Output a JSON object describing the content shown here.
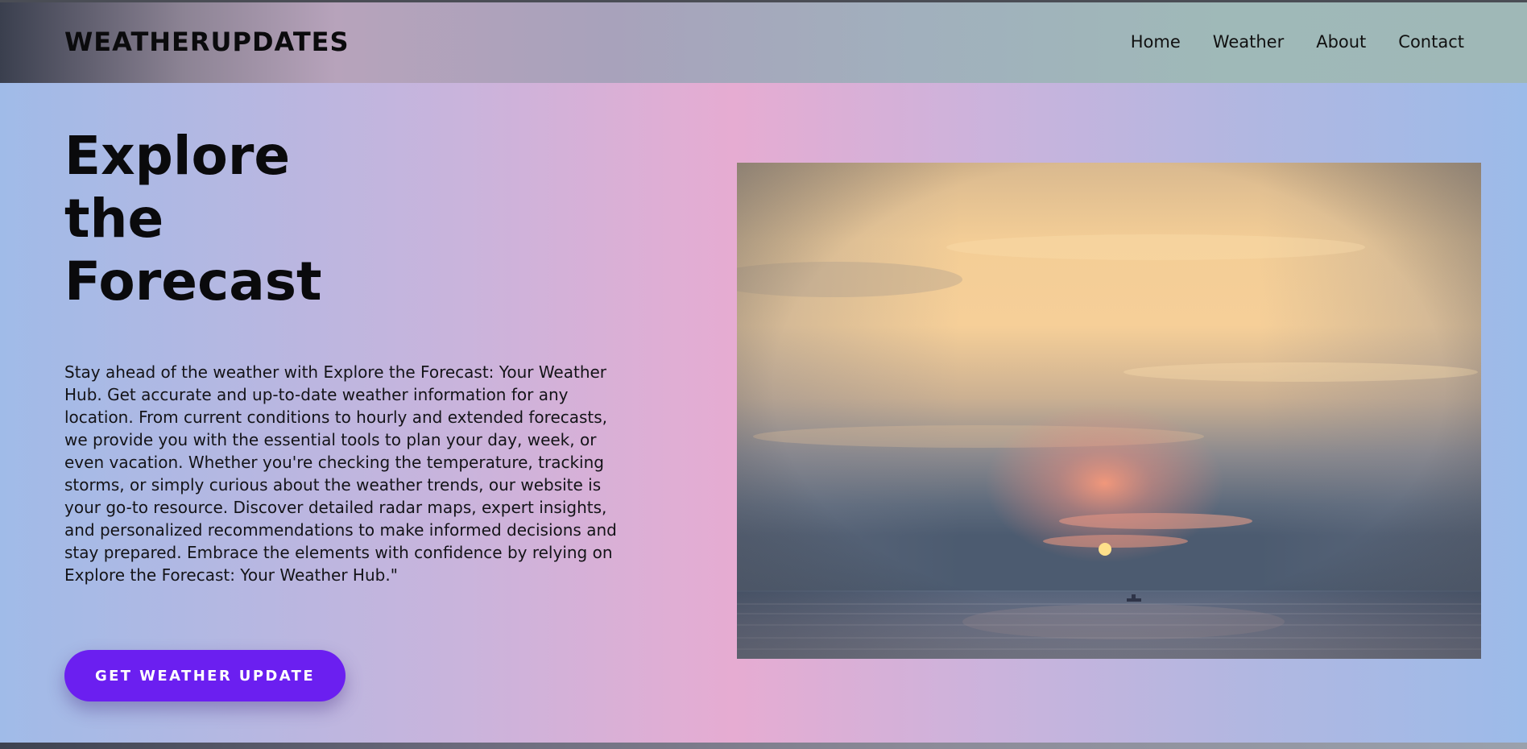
{
  "header": {
    "brand": "WEATHERUPDATES",
    "nav": [
      {
        "label": "Home"
      },
      {
        "label": "Weather"
      },
      {
        "label": "About"
      },
      {
        "label": "Contact"
      }
    ]
  },
  "hero": {
    "title_lines": [
      "Explore",
      "the",
      "Forecast"
    ],
    "description": "Stay ahead of the weather with Explore the Forecast: Your Weather Hub. Get accurate and up-to-date weather information for any location. From current conditions to hourly and extended forecasts, we provide you with the essential tools to plan your day, week, or even vacation. Whether you're checking the temperature, tracking storms, or simply curious about the weather trends, our website is your go-to resource. Discover detailed radar maps, expert insights, and personalized recommendations to make informed decisions and stay prepared. Embrace the elements with confidence by relying on Explore the Forecast: Your Weather Hub.\"",
    "cta_label": "GET WEATHER UPDATE"
  },
  "colors": {
    "cta_background": "#6b1ff0",
    "cta_text": "#ffffff",
    "brand_text": "#0b0b0d"
  }
}
